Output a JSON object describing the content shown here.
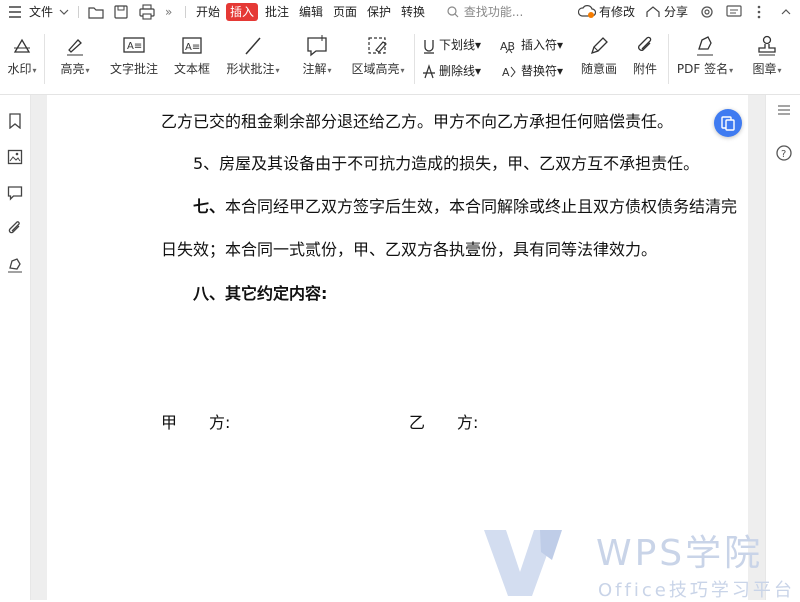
{
  "menubar": {
    "file_label": "文件",
    "tabs": [
      "开始",
      "插入",
      "批注",
      "编辑",
      "页面",
      "保护",
      "转换"
    ],
    "active_tab_index": 1,
    "search_placeholder": "查找功能...",
    "modified_label": "有修改",
    "share_label": "分享"
  },
  "ribbon": {
    "watermark": "水印",
    "highlight": "高亮",
    "text_comment": "文字批注",
    "textbox": "文本框",
    "shape_comment": "形状批注",
    "annotation": "注解",
    "area_highlight": "区域高亮",
    "underline": "下划线",
    "strikethrough": "删除线",
    "insert_symbol": "插入符",
    "replace_symbol": "替换符",
    "freehand": "随意画",
    "attachment": "附件",
    "pdf_sign": "PDF 签名",
    "stamp": "图章"
  },
  "document": {
    "line1": "乙方已交的租金剩余部分退还给乙方。甲方不向乙方承担任何赔偿责任。",
    "line2": "5、房屋及其设备由于不可抗力造成的损失，甲、乙双方互不承担责任。",
    "line3_head": "七、",
    "line3_body": "本合同经甲乙双方签字后生效，本合同解除或终止且双方债权债务结清完",
    "line4": "日失效；本合同一式贰份，甲、乙双方各执壹份，具有同等法律效力。",
    "line5": "八、其它约定内容:",
    "party_a": "甲　　方:",
    "party_b": "乙　　方:"
  },
  "watermark": {
    "brand": "WPS学院",
    "subtitle": "Office技巧学习平台"
  },
  "colors": {
    "accent_red": "#e53935",
    "float_button_blue": "#3f7bf1",
    "watermark": "#c9d4e8"
  }
}
